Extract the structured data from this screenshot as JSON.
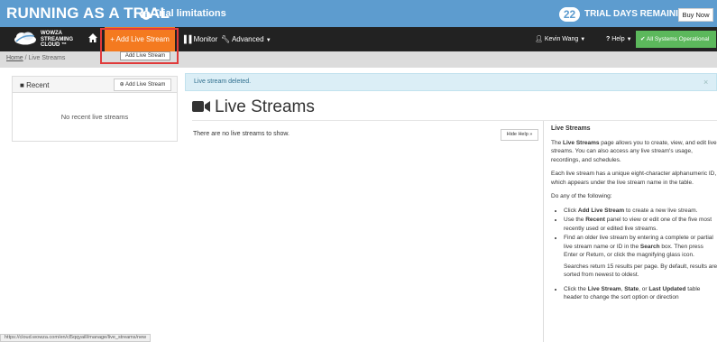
{
  "trial_bar": {
    "title": "RUNNING AS A TRIAL",
    "limits_label": "Trial limitations",
    "days_count": "22",
    "days_text": "TRIAL DAYS REMAINING",
    "buy_now": "Buy Now",
    "color": "#5d9ccf"
  },
  "navbar": {
    "logo_lines": [
      "WOWZA",
      "STREAMING",
      "CLOUD ™"
    ],
    "add_live_stream": "+ Add Live Stream",
    "monitor": "Monitor",
    "advanced": "Advanced",
    "user": "Kevin Wang",
    "help": "Help",
    "status": "All Systems Operational",
    "accent": "#f47a20",
    "status_color": "#5cb85c"
  },
  "breadcrumb": {
    "home": "Home",
    "separator": " / ",
    "current": "Live Streams"
  },
  "tooltip": "Add Live Stream",
  "recent": {
    "title": "Recent",
    "add_button": "Add Live Stream",
    "empty": "No recent live streams"
  },
  "alert": {
    "text": "Live stream deleted.",
    "close": "×"
  },
  "main": {
    "title": "Live Streams",
    "empty": "There are no live streams to show.",
    "hide_help": "Hide Help »"
  },
  "help": {
    "title": "Live Streams",
    "p1_pre": "The ",
    "p1_bold": "Live Streams",
    "p1_post": " page allows you to create, view, and edit live streams. You can also access any live stream's usage, recordings, and schedules.",
    "p2": "Each live stream has a unique eight-character alphanumeric ID, which appears under the live stream name in the table.",
    "p3": "Do any of the following:",
    "li1_pre": "Click ",
    "li1_bold": "Add Live Stream",
    "li1_post": " to create a new live stream.",
    "li2_pre": "Use the ",
    "li2_bold": "Recent",
    "li2_post": " panel to view or edit one of the five most recently used or edited live streams.",
    "li3_pre": "Find an older live stream by entering a complete or partial live stream name or ID in the ",
    "li3_bold": "Search",
    "li3_post": " box. Then press Enter or Return, or click the magnifying glass icon.",
    "sub": "Searches return 15 results per page. By default, results are sorted from newest to oldest.",
    "li4_pre": "Click the ",
    "li4_b1": "Live Stream",
    "li4_mid1": ", ",
    "li4_b2": "State",
    "li4_mid2": ", or ",
    "li4_b3": "Last Updated",
    "li4_post": " table header to change the sort option or direction"
  },
  "status_url": "https://cloud.wowza.com/en/cl5qqyaill/manage/live_streams/new"
}
